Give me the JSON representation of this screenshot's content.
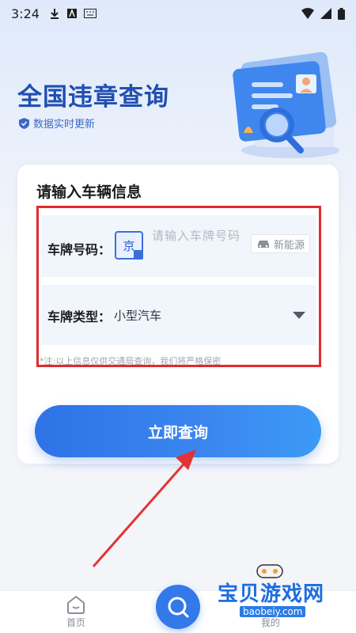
{
  "status_bar": {
    "time": "3:24"
  },
  "header": {
    "title": "全国违章查询",
    "subtitle": "数据实时更新"
  },
  "card": {
    "title": "请输入车辆信息",
    "plate": {
      "label": "车牌号码：",
      "province": "京",
      "placeholder": "请输入车牌号码",
      "new_energy_label": "新能源"
    },
    "type": {
      "label": "车牌类型：",
      "value": "小型汽车"
    },
    "note": "*注:以上信息仅供交通局查询，我们将严格保密",
    "query_button": "立即查询"
  },
  "bottom_nav": {
    "home_label": "首页",
    "mine_label": "我的"
  },
  "watermark": {
    "text": "宝贝游戏网",
    "url": "baobeiy.com"
  },
  "colors": {
    "primary": "#2d73e6",
    "title": "#1f4fb3",
    "highlight_box": "#e02b2b"
  }
}
